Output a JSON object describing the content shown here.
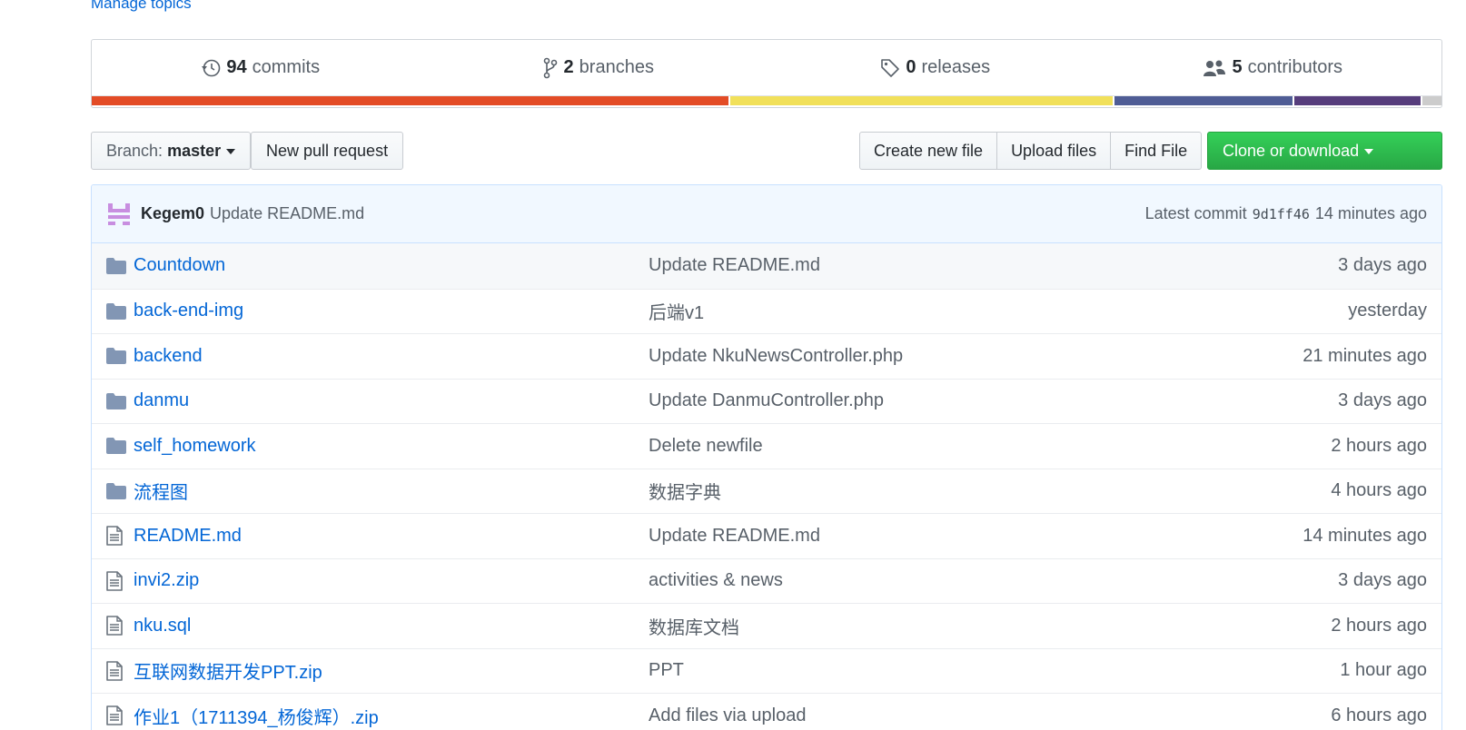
{
  "repo_header": {
    "manage_topics": "Manage topics"
  },
  "summary": {
    "commits": {
      "count": "94",
      "label": "commits",
      "icon": "history-icon"
    },
    "branches": {
      "count": "2",
      "label": "branches",
      "icon": "git-branch-icon"
    },
    "releases": {
      "count": "0",
      "label": "releases",
      "icon": "tag-icon"
    },
    "contributors": {
      "count": "5",
      "label": "contributors",
      "icon": "people-icon"
    }
  },
  "language_bar": [
    {
      "color": "#e34c26",
      "percent": 47.3
    },
    {
      "color": "#f1e05a",
      "percent": 28.5
    },
    {
      "color": "#4F5D95",
      "percent": 13.3
    },
    {
      "color": "#563d7c",
      "percent": 9.5
    },
    {
      "color": "#cccccc",
      "percent": 1.4
    }
  ],
  "toolbar": {
    "branch_prefix": "Branch:",
    "branch_name": "master",
    "new_pull_request": "New pull request",
    "create_new_file": "Create new file",
    "upload_files": "Upload files",
    "find_file": "Find File",
    "clone_or_download": "Clone or download"
  },
  "latest_commit": {
    "author": "Kegem0",
    "message": "Update README.md",
    "label": "Latest commit",
    "sha": "9d1ff46",
    "age": "14 minutes ago"
  },
  "files": [
    {
      "type": "folder",
      "icon": "folder-icon",
      "name": "Countdown",
      "message": "Update README.md",
      "age": "3 days ago"
    },
    {
      "type": "folder",
      "icon": "folder-icon",
      "name": "back-end-img",
      "message": "后端v1",
      "age": "yesterday"
    },
    {
      "type": "folder",
      "icon": "folder-icon",
      "name": "backend",
      "message": "Update NkuNewsController.php",
      "age": "21 minutes ago"
    },
    {
      "type": "folder",
      "icon": "folder-icon",
      "name": "danmu",
      "message": "Update DanmuController.php",
      "age": "3 days ago"
    },
    {
      "type": "folder",
      "icon": "folder-icon",
      "name": "self_homework",
      "message": "Delete newfile",
      "age": "2 hours ago"
    },
    {
      "type": "folder",
      "icon": "folder-icon",
      "name": "流程图",
      "message": "数据字典",
      "age": "4 hours ago"
    },
    {
      "type": "file",
      "icon": "file-icon",
      "name": "README.md",
      "message": "Update README.md",
      "age": "14 minutes ago"
    },
    {
      "type": "file",
      "icon": "file-icon",
      "name": "invi2.zip",
      "message": "activities & news",
      "age": "3 days ago"
    },
    {
      "type": "file",
      "icon": "file-icon",
      "name": "nku.sql",
      "message": "数据库文档",
      "age": "2 hours ago"
    },
    {
      "type": "file",
      "icon": "file-icon",
      "name": "互联网数据开发PPT.zip",
      "message": "PPT",
      "age": "1 hour ago"
    },
    {
      "type": "file",
      "icon": "file-icon",
      "name": "作业1（1711394_杨俊辉）.zip",
      "message": "Add files via upload",
      "age": "6 hours ago"
    }
  ]
}
